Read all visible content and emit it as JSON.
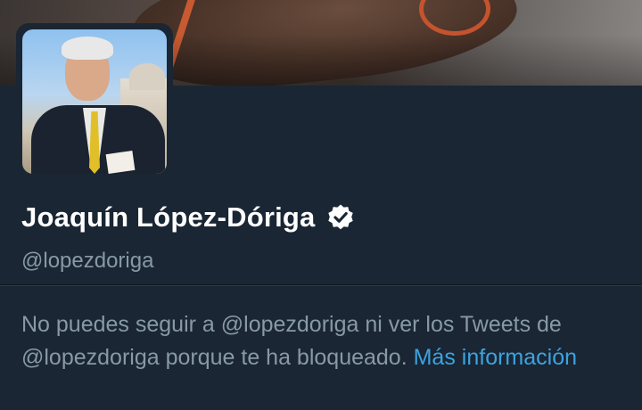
{
  "profile": {
    "display_name": "Joaquín López-Dóriga",
    "handle": "@lopezdoriga",
    "verified_icon": "verified-badge-icon"
  },
  "blocked_notice": {
    "message": "No puedes seguir a @lopezdoriga ni ver los Tweets de @lopezdoriga porque te ha bloqueado. ",
    "link_label": "Más información"
  },
  "colors": {
    "background": "#1a2633",
    "name": "#ffffff",
    "secondary_text": "#8899a6",
    "link": "#3da3e0"
  }
}
